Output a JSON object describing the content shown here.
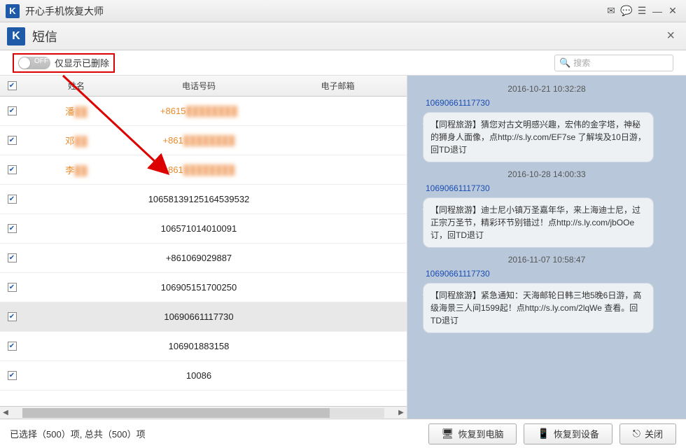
{
  "app": {
    "icon_letter": "K",
    "title": "开心手机恢复大师"
  },
  "subheader": {
    "icon_letter": "K",
    "title": "短信"
  },
  "toolbar": {
    "toggle_off": "OFF",
    "toggle_label": "仅显示已删除",
    "search_placeholder": "搜索"
  },
  "table": {
    "headers": {
      "name": "姓名",
      "phone": "电话号码",
      "email": "电子邮箱"
    },
    "rows": [
      {
        "checked": true,
        "name": "潘",
        "phone": "+8615",
        "blur": true,
        "orange": true
      },
      {
        "checked": true,
        "name": "邓",
        "phone": "+861",
        "blur": true,
        "orange": true
      },
      {
        "checked": true,
        "name": "李",
        "phone": "+861",
        "blur": true,
        "orange": true
      },
      {
        "checked": true,
        "name": "",
        "phone": "10658139125164539532",
        "orange": false
      },
      {
        "checked": true,
        "name": "",
        "phone": "106571014010091",
        "orange": false
      },
      {
        "checked": true,
        "name": "",
        "phone": "+861069029887",
        "orange": false
      },
      {
        "checked": true,
        "name": "",
        "phone": "106905151700250",
        "orange": false
      },
      {
        "checked": true,
        "name": "",
        "phone": "10690661117730",
        "orange": false,
        "selected": true
      },
      {
        "checked": true,
        "name": "",
        "phone": "106901883158",
        "orange": false
      },
      {
        "checked": true,
        "name": "",
        "phone": "10086",
        "orange": false
      }
    ]
  },
  "messages": [
    {
      "date": "2016-10-21 10:32:28",
      "sender": "10690661117730",
      "text": "【同程旅游】猜您对古文明感兴趣，宏伟的金字塔，神秘的狮身人面像，点http://s.ly.com/EF7se 了解埃及10日游，回TD退订"
    },
    {
      "date": "2016-10-28 14:00:33",
      "sender": "10690661117730",
      "text": "【同程旅游】迪士尼小镇万圣嘉年华，来上海迪士尼，过正宗万圣节，精彩环节别错过！点http://s.ly.com/jbOOe 订，回TD退订"
    },
    {
      "date": "2016-11-07 10:58:47",
      "sender": "10690661117730",
      "text": "【同程旅游】紧急通知：天海邮轮日韩三地5晚6日游，高级海景三人间1599起！点http://s.ly.com/2lqWe 查看。回TD退订"
    }
  ],
  "footer": {
    "status": "已选择（500）项, 总共（500）项",
    "btn_pc": "恢复到电脑",
    "btn_device": "恢复到设备",
    "btn_close": "关闭"
  }
}
